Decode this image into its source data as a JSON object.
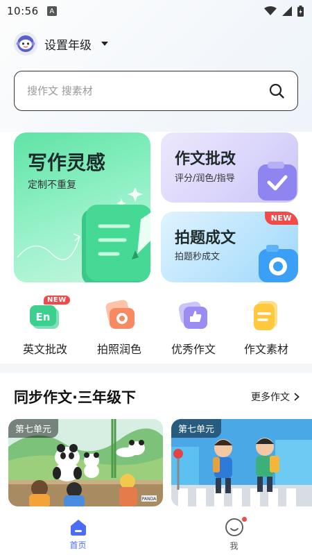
{
  "status_bar": {
    "time": "10:56",
    "a_icon": "A"
  },
  "header": {
    "grade_label": "设置年级"
  },
  "search": {
    "placeholder": "搜作文 搜素材"
  },
  "cards": {
    "inspiration": {
      "title": "写作灵感",
      "subtitle": "定制不重复"
    },
    "correction": {
      "title": "作文批改",
      "subtitle": "评分/润色/指导"
    },
    "photo_essay": {
      "title": "拍题成文",
      "subtitle": "拍题秒成文",
      "badge": "NEW"
    }
  },
  "tools": [
    {
      "label": "英文批改",
      "icon_text": "En",
      "badge": "NEW"
    },
    {
      "label": "拍照润色"
    },
    {
      "label": "优秀作文"
    },
    {
      "label": "作文素材"
    }
  ],
  "section": {
    "title": "同步作文·三年级下",
    "more": "更多作文"
  },
  "essays": [
    {
      "unit": "第七单元",
      "sign": "PANDA"
    },
    {
      "unit": "第七单元"
    }
  ],
  "nav": {
    "home": "首页",
    "me": "我"
  },
  "colors": {
    "accent": "#4a6cf7",
    "badge": "#f24a4a",
    "green": "#3ed894"
  }
}
